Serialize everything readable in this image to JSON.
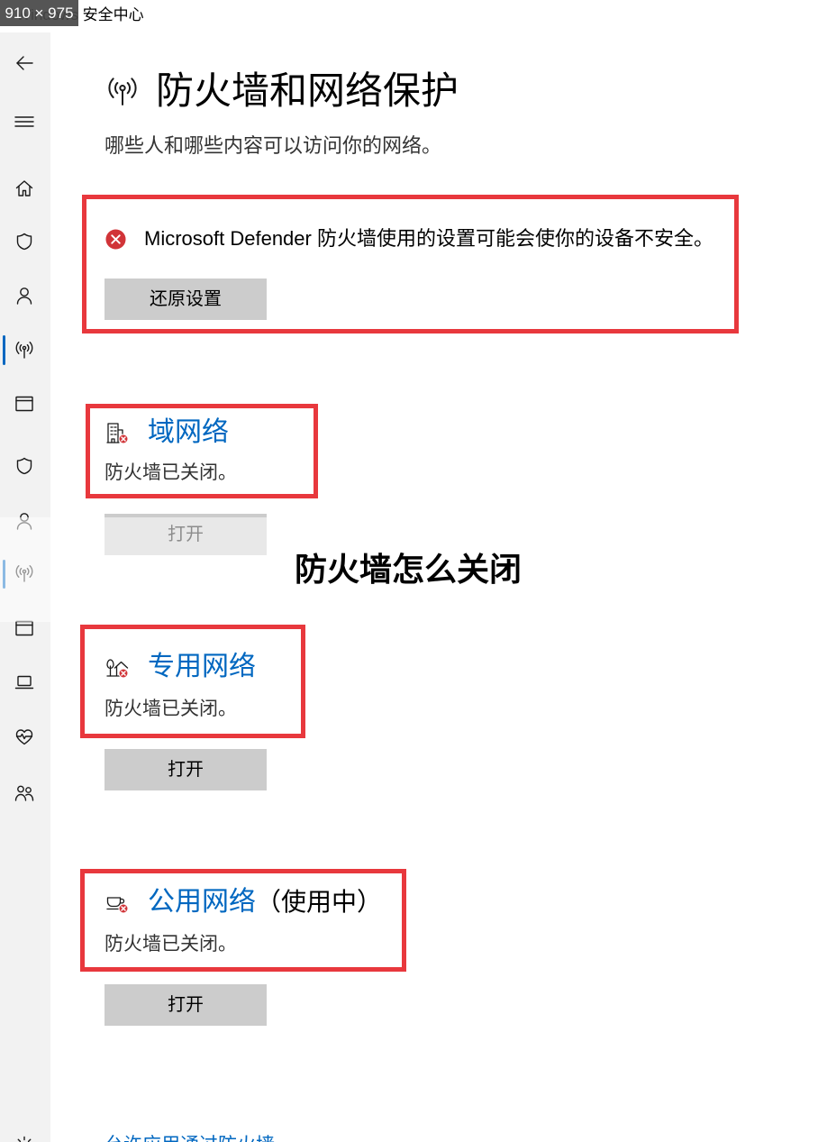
{
  "window": {
    "title": "Windows 安全中心",
    "size_badge": "910 × 975"
  },
  "sidebar": {
    "items": [
      {
        "icon": "back-arrow-icon"
      },
      {
        "icon": "menu-icon"
      },
      {
        "icon": "home-icon"
      },
      {
        "icon": "virus-protection-shield-icon"
      },
      {
        "icon": "account-protection-icon"
      },
      {
        "icon": "firewall-network-icon",
        "selected": true
      },
      {
        "icon": "app-browser-control-icon"
      },
      {
        "icon": "virus-protection-shield-icon"
      },
      {
        "icon": "account-protection-icon"
      },
      {
        "icon": "firewall-network-icon",
        "selected": true
      },
      {
        "icon": "app-browser-control-icon"
      },
      {
        "icon": "device-security-laptop-icon"
      },
      {
        "icon": "device-health-heart-icon"
      },
      {
        "icon": "family-options-icon"
      },
      {
        "icon": "settings-gear-icon"
      }
    ]
  },
  "page": {
    "icon": "firewall-network-icon",
    "title": "防火墙和网络保护",
    "subtitle": "哪些人和哪些内容可以访问你的网络。"
  },
  "alert": {
    "icon": "error-icon",
    "message": "Microsoft Defender 防火墙使用的设置可能会使你的设备不安全。",
    "button": "还原设置"
  },
  "networks": [
    {
      "icon": "domain-network-icon",
      "name": "域网络",
      "status": "防火墙已关闭。",
      "button": "打开"
    },
    {
      "icon": "private-network-icon",
      "name": "专用网络",
      "status": "防火墙已关闭。",
      "button": "打开"
    },
    {
      "icon": "public-network-icon",
      "name": "公用网络",
      "in_use": "（使用中）",
      "status": "防火墙已关闭。",
      "button": "打开"
    }
  ],
  "watermark": "防火墙怎么关闭",
  "footer_link": "允许应用通过防火墙",
  "colors": {
    "accent": "#0067c0",
    "highlight_border": "#e8383d",
    "error": "#d13438",
    "button": "#cccccc",
    "sidebar": "#f2f2f2"
  }
}
